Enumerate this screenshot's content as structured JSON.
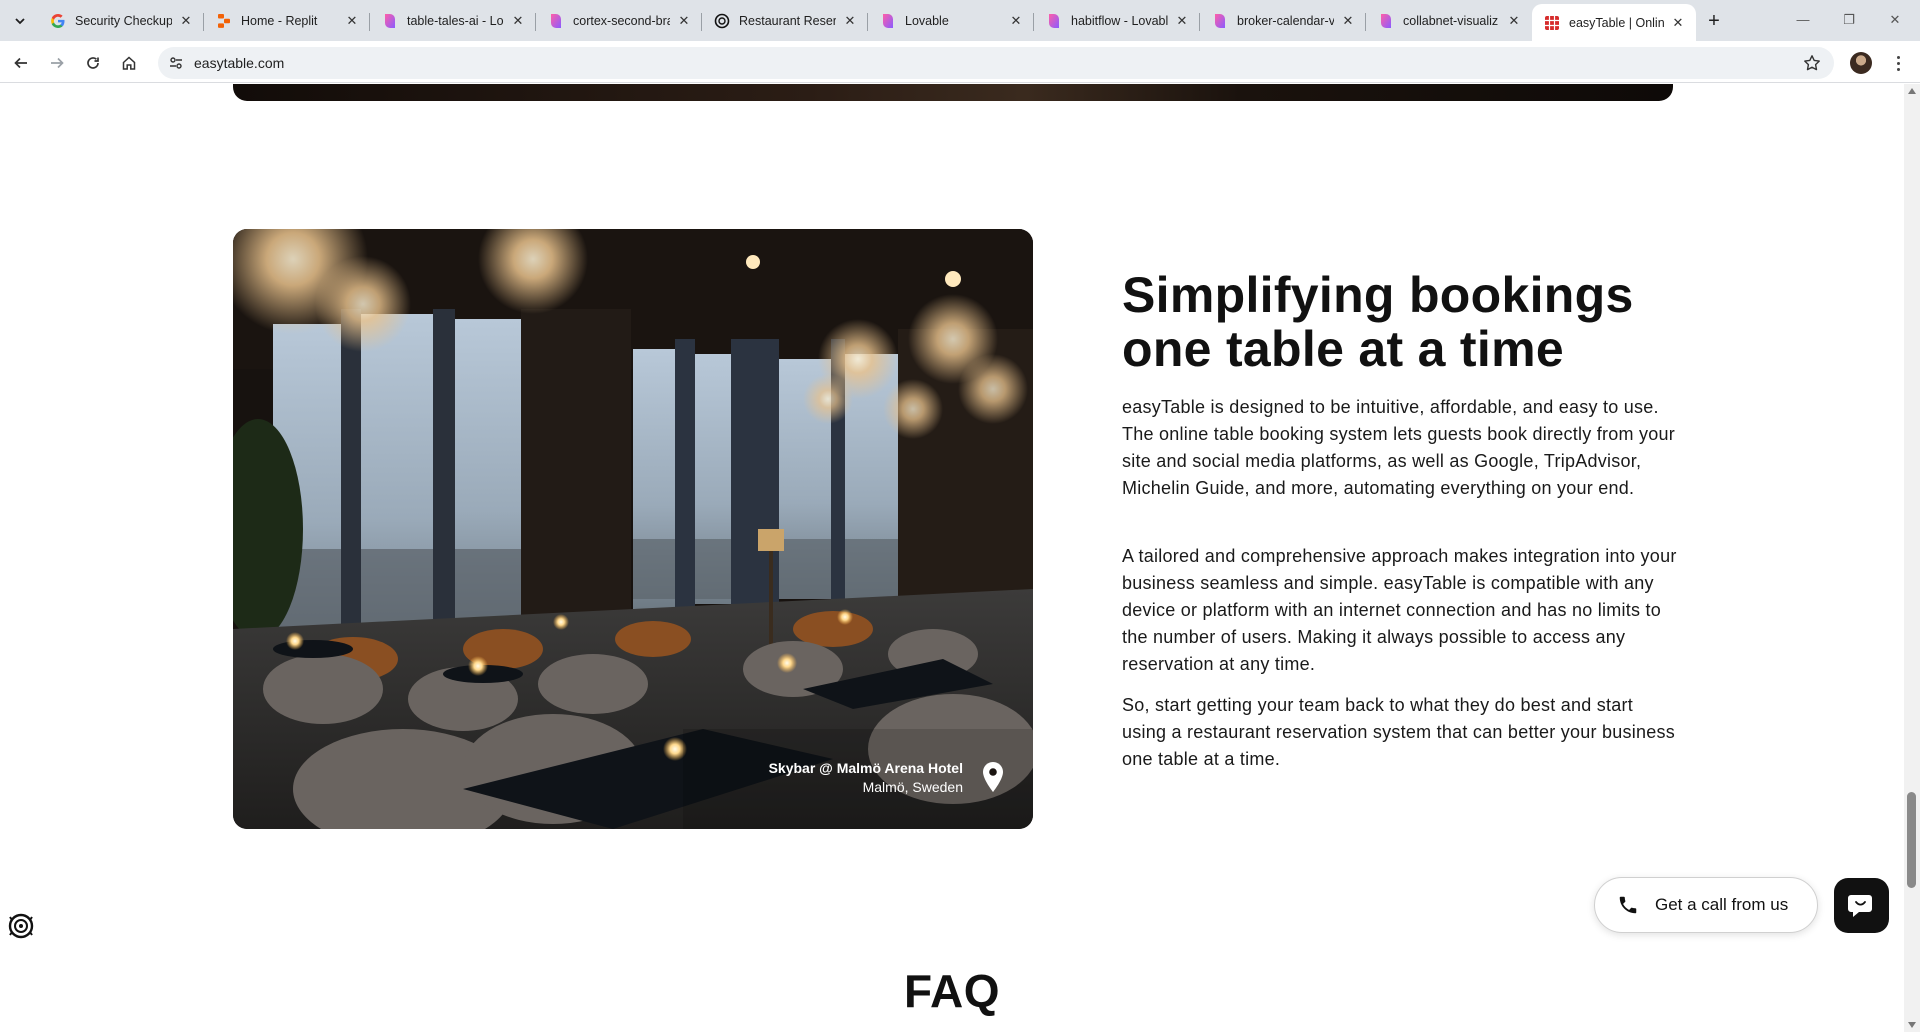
{
  "browser": {
    "tabs": [
      {
        "title": "Security Checkup",
        "icon": "google-icon",
        "active": false
      },
      {
        "title": "Home - Replit",
        "icon": "replit-icon",
        "active": false
      },
      {
        "title": "table-tales-ai - Lo",
        "icon": "lovable-icon",
        "active": false
      },
      {
        "title": "cortex-second-bra",
        "icon": "lovable-icon",
        "active": false
      },
      {
        "title": "Restaurant Reserva",
        "icon": "openai-icon",
        "active": false
      },
      {
        "title": "Lovable",
        "icon": "lovable-icon",
        "active": false
      },
      {
        "title": "habitflow - Lovabl",
        "icon": "lovable-icon",
        "active": false
      },
      {
        "title": "broker-calendar-vi",
        "icon": "lovable-icon",
        "active": false
      },
      {
        "title": "collabnet-visualiz",
        "icon": "lovable-icon",
        "active": false
      },
      {
        "title": "easyTable | Online",
        "icon": "easytable-icon",
        "active": true
      }
    ],
    "url": "easytable.com"
  },
  "section": {
    "headline_line1": "Simplifying bookings",
    "headline_line2": "one table at a time",
    "paragraph1": "easyTable is designed to be intuitive, affordable, and easy to use. The online table booking system lets guests book directly from your site and social media platforms, as well as Google, TripAdvisor, Michelin Guide, and more, automating everything on your end.",
    "paragraph2": "A tailored and comprehensive approach makes integration into your business seamless and simple. easyTable is compatible with any device or platform with an internet connection and has no limits to the number of users. Making it always possible to access any reservation at any time.",
    "paragraph3": "So, start getting your team back to what they do best and start using a restaurant reservation system that can better your business one table at a time."
  },
  "photo": {
    "venue_name": "Skybar @ Malmö Arena Hotel",
    "location": "Malmö, Sweden",
    "icon": "location-pin-icon"
  },
  "faq": {
    "heading": "FAQ"
  },
  "widgets": {
    "call_label": "Get a call from us",
    "call_icon": "phone-icon",
    "chat_icon": "chat-icon",
    "accessibility_icon": "accessibility-icon"
  },
  "colors": {
    "text": "#111111",
    "chat_button": "#111111",
    "tabstrip": "#dfe3e8"
  }
}
